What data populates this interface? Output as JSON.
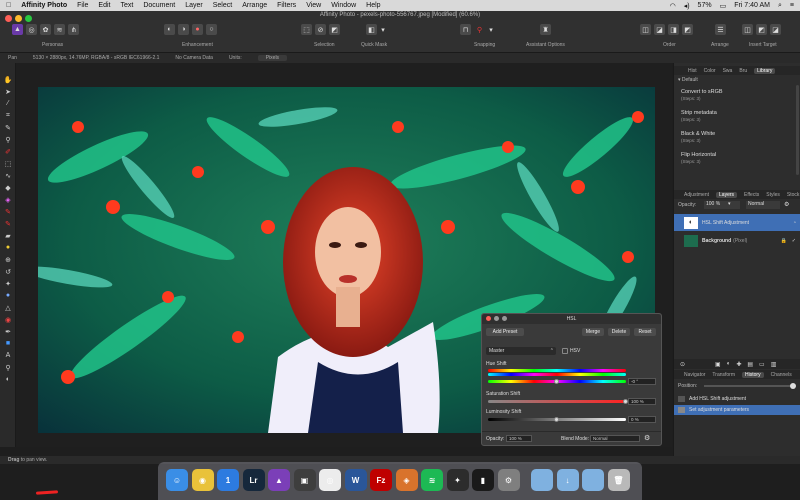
{
  "menubar": {
    "app_name": "Affinity Photo",
    "items": [
      "File",
      "Edit",
      "Text",
      "Document",
      "Layer",
      "Select",
      "Arrange",
      "Filters",
      "View",
      "Window",
      "Help"
    ],
    "battery": "57%",
    "clock": "Fri 7:40 AM"
  },
  "window": {
    "title": "Affinity Photo - pexels-photo-556767.jpeg [Modified] (60.6%)"
  },
  "toolbar": {
    "personas_label": "Personas",
    "enhancement_label": "Enhancement",
    "selection_label": "Selection",
    "quick_mask_label": "Quick Mask",
    "snapping_label": "Snapping",
    "assistant_label": "Assistant Options",
    "order_label": "Order",
    "arrange_label": "Arrange",
    "insert_target_label": "Insert Target"
  },
  "context_bar": {
    "tool": "Pan",
    "doc_info": "5130 × 2880px, 14.76MP, RGBA/8 - sRGB IEC61966-2.1",
    "camera": "No Camera Data",
    "units_label": "Units:",
    "units_value": "Pixels"
  },
  "status_bar": {
    "hint_bold": "Drag",
    "hint_rest": "to pan view."
  },
  "right_panel": {
    "top_tabs": [
      "Hist",
      "Color",
      "Swa",
      "Bru",
      "Library"
    ],
    "active_top_tab": "Library",
    "library_category": "Default",
    "macros": [
      {
        "name": "Convert to sRGB",
        "steps": "(Steps: 3)"
      },
      {
        "name": "Strip metadata",
        "steps": "(Steps: 3)"
      },
      {
        "name": "Black & White",
        "steps": "(Steps: 3)"
      },
      {
        "name": "Flip Horizontal",
        "steps": "(Steps: 3)"
      }
    ],
    "mid_tabs": [
      "Adjustment",
      "Layers",
      "Effects",
      "Styles",
      "Stock"
    ],
    "active_mid_tab": "Layers",
    "opacity_label": "Opacity:",
    "opacity_value": "100 %",
    "blend_value": "Normal",
    "layers": [
      {
        "name": "HSL Shift Adjustment",
        "selected": true
      },
      {
        "name": "Background",
        "suffix": "(Pixel)",
        "selected": false
      }
    ],
    "bottom_tabs": [
      "Navigator",
      "Transform",
      "History",
      "Channels"
    ],
    "active_bottom_tab": "History",
    "position_label": "Position:",
    "history": [
      {
        "name": "Add HSL Shift adjustment",
        "selected": false
      },
      {
        "name": "Set adjustment parameters",
        "selected": true
      }
    ]
  },
  "hsl_dialog": {
    "title": "HSL",
    "add_preset": "Add Preset",
    "merge": "Merge",
    "delete": "Delete",
    "reset": "Reset",
    "channel": "Master",
    "hsv_label": "HSV",
    "hue_label": "Hue Shift",
    "hue_value": "-0 °",
    "hue_level": 0.5,
    "saturation_label": "Saturation Shift",
    "saturation_value": "100 %",
    "saturation_level": 1.0,
    "luminosity_label": "Luminosity Shift",
    "luminosity_value": "0 %",
    "luminosity_level": 0.5,
    "opacity_label": "Opacity:",
    "opacity_value": "100 %",
    "blend_label": "Blend Mode:",
    "blend_value": "Normal"
  },
  "dock": {
    "apps": [
      {
        "icon": "finder-icon",
        "glyph": "☺",
        "color": "#3a8ee6"
      },
      {
        "icon": "chrome-icon",
        "glyph": "◉",
        "color": "#e9c23a"
      },
      {
        "icon": "1password-icon",
        "glyph": "1",
        "color": "#2d7be0"
      },
      {
        "icon": "lightroom-icon",
        "glyph": "Lr",
        "color": "#16283c"
      },
      {
        "icon": "affinity-photo-icon",
        "glyph": "▲",
        "color": "#7b3fb8"
      },
      {
        "icon": "photo-app-icon",
        "glyph": "▣",
        "color": "#3e3e3e"
      },
      {
        "icon": "camera-icon",
        "glyph": "◎",
        "color": "#ececec"
      },
      {
        "icon": "word-icon",
        "glyph": "W",
        "color": "#2a5699"
      },
      {
        "icon": "filezilla-icon",
        "glyph": "Fz",
        "color": "#bf0000"
      },
      {
        "icon": "compass-icon",
        "glyph": "◈",
        "color": "#d9732c"
      },
      {
        "icon": "spotify-icon",
        "glyph": "≋",
        "color": "#1db954"
      },
      {
        "icon": "davinci-icon",
        "glyph": "✦",
        "color": "#2c2c2c"
      },
      {
        "icon": "phone-app-icon",
        "glyph": "▮",
        "color": "#1a1a1a"
      },
      {
        "icon": "system-preferences-icon",
        "glyph": "⚙",
        "color": "#7f7f7f"
      },
      {
        "icon": "folder-icon",
        "glyph": "",
        "color": "#7fb1e0"
      },
      {
        "icon": "downloads-folder-icon",
        "glyph": "↓",
        "color": "#7fb1e0"
      },
      {
        "icon": "documents-folder-icon",
        "glyph": "",
        "color": "#7fb1e0"
      },
      {
        "icon": "trash-icon",
        "glyph": "🗑",
        "color": "#b9b9b9"
      }
    ]
  }
}
